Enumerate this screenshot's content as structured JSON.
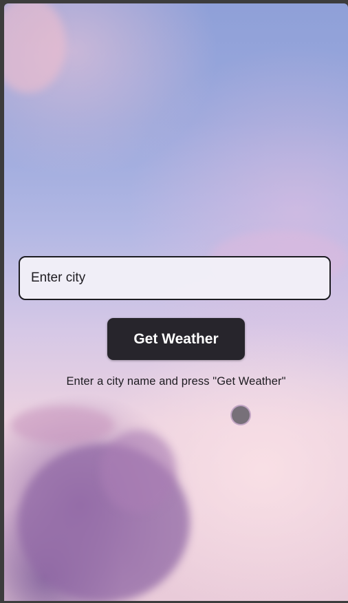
{
  "search": {
    "placeholder": "Enter city",
    "value": ""
  },
  "button": {
    "label": "Get Weather"
  },
  "status": {
    "message": "Enter a city name and press \"Get Weather\""
  },
  "icons": {
    "loading": "loading-indicator-icon"
  }
}
